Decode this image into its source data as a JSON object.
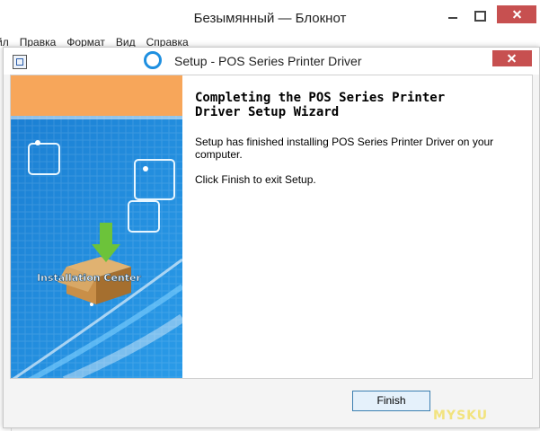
{
  "notepad": {
    "title": "Безымянный — Блокнот",
    "menu": [
      "йл",
      "Правка",
      "Формат",
      "Вид",
      "Справка"
    ]
  },
  "setup": {
    "title": "Setup - POS Series Printer Driver",
    "side_image_caption": "Installation Center",
    "heading_line1": "Completing the POS Series Printer",
    "heading_line2": "Driver Setup Wizard",
    "description": "Setup has finished installing POS Series Printer Driver on your computer.",
    "instruction": "Click Finish to exit Setup.",
    "finish_label": "Finish"
  },
  "watermark": "MYSKU",
  "colors": {
    "banner_orange": "#f7a65a",
    "panel_blue": "#1a86d8",
    "button_border": "#3c7fb1",
    "close_red": "#c75050"
  },
  "icons": {
    "window_controls": [
      "minimize-icon",
      "maximize-icon",
      "close-icon"
    ],
    "setup_app": "setup-app-icon",
    "dialog_ring": "ring-icon",
    "side_art": [
      "box-icon",
      "download-arrow-icon"
    ]
  }
}
